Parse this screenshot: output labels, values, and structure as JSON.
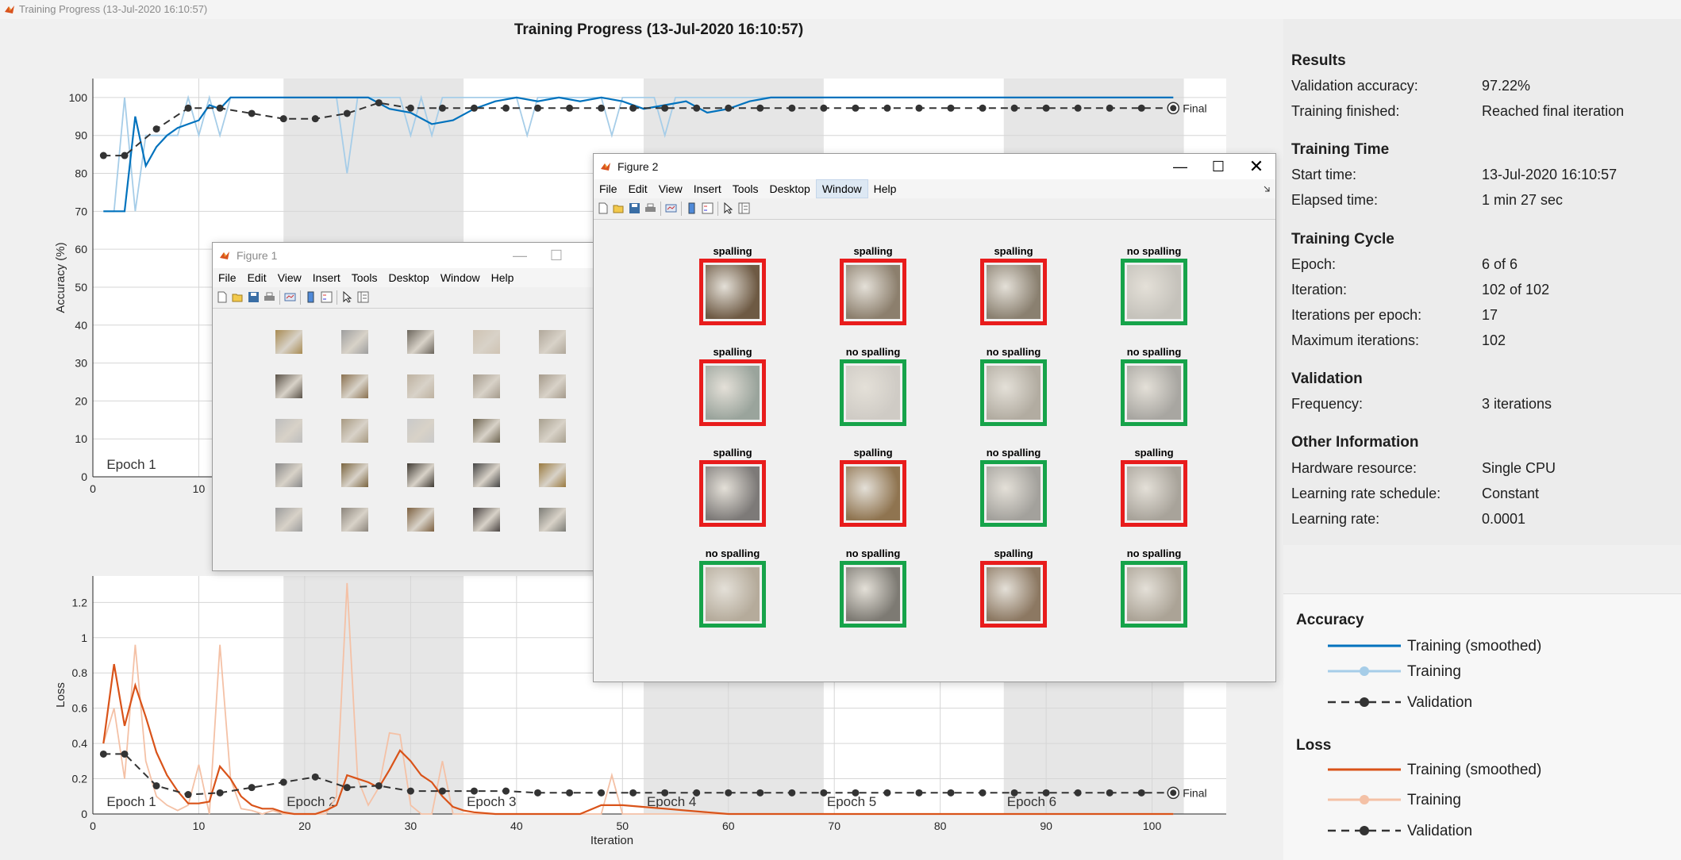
{
  "app_title": "Training Progress (13-Jul-2020 16:10:57)",
  "chart_title": "Training Progress (13-Jul-2020 16:10:57)",
  "colors": {
    "train_smooth_acc": "#0072BD",
    "train_acc": "#a6cde8",
    "train_smooth_loss": "#D95319",
    "train_loss": "#f4c1a6",
    "validation": "#333333",
    "epoch_shade": "#e6e6e6",
    "correct_border": "#16a34a",
    "wrong_border": "#e81c1c"
  },
  "chart_data": [
    {
      "type": "line",
      "ylabel": "Accuracy (%)",
      "xlim": [
        0,
        107
      ],
      "ylim": [
        0,
        105
      ],
      "yticks": [
        0,
        10,
        20,
        30,
        40,
        50,
        60,
        70,
        80,
        90,
        100
      ],
      "xticks": [
        0,
        10
      ],
      "epoch_labels": [
        "Epoch 1"
      ],
      "final_label": "Final",
      "series": [
        {
          "name": "Training (smoothed)",
          "x": [
            1,
            2,
            3,
            4,
            5,
            6,
            7,
            8,
            9,
            10,
            11,
            12,
            13,
            14,
            15,
            16,
            18,
            20,
            22,
            24,
            26,
            28,
            30,
            32,
            34,
            36,
            38,
            40,
            42,
            44,
            46,
            48,
            50,
            52,
            54,
            56,
            58,
            60,
            62,
            64,
            66,
            68,
            70,
            72,
            74,
            76,
            78,
            80,
            82,
            84,
            86,
            88,
            90,
            92,
            94,
            96,
            98,
            100,
            102
          ],
          "y": [
            70,
            70,
            70,
            95,
            82,
            87,
            90,
            92,
            93,
            94,
            98,
            97,
            100,
            100,
            100,
            100,
            100,
            100,
            100,
            100,
            100,
            97,
            96,
            93,
            94,
            97,
            99,
            100,
            99,
            100,
            99,
            100,
            99,
            97,
            98,
            99,
            96,
            97,
            99,
            100,
            100,
            100,
            100,
            100,
            100,
            100,
            100,
            100,
            100,
            100,
            100,
            100,
            100,
            100,
            100,
            100,
            100,
            100,
            100
          ]
        },
        {
          "name": "Training",
          "x": [
            1,
            2,
            3,
            4,
            5,
            6,
            7,
            8,
            9,
            10,
            11,
            12,
            13,
            14,
            15,
            16,
            18,
            20,
            22,
            23,
            24,
            25,
            26,
            27,
            28,
            29,
            30,
            31,
            32,
            33,
            34,
            35,
            36,
            38,
            40,
            41,
            42,
            43,
            44,
            45,
            46,
            47,
            48,
            49,
            50,
            51,
            52,
            53,
            54,
            55,
            56,
            58,
            60,
            62,
            64,
            66,
            68,
            70,
            72,
            74,
            76,
            78,
            80,
            82,
            84,
            86,
            88,
            90,
            92,
            94,
            96,
            98,
            100,
            102
          ],
          "y": [
            70,
            70,
            100,
            70,
            90,
            90,
            90,
            90,
            100,
            90,
            100,
            90,
            100,
            100,
            100,
            100,
            100,
            100,
            100,
            100,
            80,
            100,
            100,
            100,
            100,
            100,
            90,
            100,
            90,
            100,
            100,
            100,
            100,
            100,
            100,
            90,
            100,
            100,
            100,
            100,
            100,
            100,
            100,
            90,
            100,
            100,
            100,
            100,
            90,
            100,
            100,
            100,
            100,
            100,
            100,
            100,
            100,
            100,
            100,
            100,
            100,
            100,
            100,
            100,
            100,
            100,
            100,
            100,
            100,
            100,
            100,
            100,
            100,
            100
          ]
        },
        {
          "name": "Validation",
          "x": [
            1,
            3,
            6,
            9,
            12,
            15,
            18,
            21,
            24,
            27,
            30,
            33,
            36,
            39,
            42,
            45,
            48,
            51,
            54,
            57,
            60,
            63,
            66,
            69,
            72,
            75,
            78,
            81,
            84,
            87,
            90,
            93,
            96,
            99,
            102
          ],
          "y": [
            84.7,
            84.7,
            91.7,
            97.2,
            97.2,
            95.8,
            94.4,
            94.4,
            95.8,
            98.6,
            97.2,
            97.2,
            97.2,
            97.2,
            97.2,
            97.2,
            97.2,
            97.2,
            97.2,
            97.2,
            97.2,
            97.2,
            97.2,
            97.2,
            97.2,
            97.2,
            97.2,
            97.2,
            97.2,
            97.2,
            97.2,
            97.2,
            97.2,
            97.2,
            97.2
          ]
        }
      ]
    },
    {
      "type": "line",
      "ylabel": "Loss",
      "xlabel": "Iteration",
      "xlim": [
        0,
        107
      ],
      "ylim": [
        0,
        1.35
      ],
      "yticks": [
        0,
        0.2,
        0.4,
        0.6,
        0.8,
        1,
        1.2
      ],
      "ytick_labels": [
        "0",
        "0.2",
        "0.4",
        "0.6",
        "0.8",
        "1",
        "1.2"
      ],
      "xticks": [
        0,
        10,
        20,
        30,
        40,
        50,
        60,
        70,
        80,
        90,
        100
      ],
      "epoch_labels": [
        "Epoch 1",
        "Epoch 2",
        "Epoch 3",
        "Epoch 4",
        "Epoch 5",
        "Epoch 6"
      ],
      "final_label": "Final",
      "series": [
        {
          "name": "Training (smoothed)",
          "x": [
            1,
            2,
            3,
            4,
            5,
            6,
            7,
            8,
            9,
            10,
            11,
            12,
            13,
            14,
            15,
            16,
            17,
            18,
            19,
            20,
            21,
            22,
            23,
            24,
            25,
            26,
            27,
            28,
            29,
            30,
            31,
            32,
            33,
            34,
            35,
            36,
            38,
            40,
            42,
            44,
            46,
            48,
            50,
            52,
            54,
            56,
            58,
            60,
            62,
            64,
            66,
            68,
            70,
            72,
            74,
            76,
            78,
            80,
            82,
            84,
            86,
            88,
            90,
            92,
            94,
            96,
            98,
            100,
            102
          ],
          "y": [
            0.4,
            0.85,
            0.5,
            0.73,
            0.55,
            0.35,
            0.22,
            0.13,
            0.06,
            0.06,
            0.07,
            0.27,
            0.2,
            0.1,
            0.05,
            0.03,
            0.03,
            0.01,
            0.0,
            0.0,
            0.0,
            0.02,
            0.05,
            0.22,
            0.2,
            0.18,
            0.15,
            0.25,
            0.36,
            0.3,
            0.22,
            0.18,
            0.1,
            0.04,
            0.02,
            0.01,
            0.0,
            0.0,
            0.0,
            0.0,
            0.0,
            0.05,
            0.05,
            0.04,
            0.03,
            0.02,
            0.01,
            0.0,
            0.0,
            0.0,
            0.0,
            0.0,
            0.0,
            0.0,
            0.0,
            0.0,
            0.0,
            0.0,
            0.0,
            0.0,
            0.0,
            0.0,
            0.0,
            0.0,
            0.0,
            0.0,
            0.0,
            0.0,
            0.0
          ]
        },
        {
          "name": "Training",
          "x": [
            1,
            2,
            3,
            4,
            5,
            6,
            7,
            8,
            9,
            10,
            11,
            12,
            13,
            14,
            15,
            16,
            17,
            18,
            19,
            20,
            21,
            22,
            23,
            24,
            25,
            26,
            27,
            28,
            29,
            30,
            31,
            32,
            33,
            34,
            35,
            36,
            38,
            40,
            42,
            44,
            46,
            48,
            49,
            50,
            52,
            54,
            56,
            58,
            60,
            62,
            64,
            66,
            68,
            70,
            72,
            74,
            76,
            78,
            80,
            82,
            84,
            86,
            88,
            90,
            92,
            94,
            96,
            98,
            100,
            102
          ],
          "y": [
            0.4,
            0.6,
            0.2,
            0.96,
            0.3,
            0.1,
            0.05,
            0.02,
            0.05,
            0.28,
            0.0,
            0.96,
            0.2,
            0.03,
            0.02,
            0.0,
            0.02,
            0.0,
            0.0,
            0.0,
            0.0,
            0.0,
            0.1,
            1.31,
            0.2,
            0.05,
            0.15,
            0.46,
            0.45,
            0.05,
            0.0,
            0.0,
            0.3,
            0.0,
            0.0,
            0.0,
            0.0,
            0.0,
            0.0,
            0.0,
            0.0,
            0.0,
            0.22,
            0.0,
            0.0,
            0.0,
            0.0,
            0.0,
            0.0,
            0.0,
            0.0,
            0.0,
            0.0,
            0.0,
            0.0,
            0.0,
            0.0,
            0.0,
            0.0,
            0.0,
            0.0,
            0.0,
            0.0,
            0.0,
            0.0,
            0.0,
            0.0,
            0.0,
            0.0,
            0.0
          ]
        },
        {
          "name": "Validation",
          "x": [
            1,
            3,
            6,
            9,
            12,
            15,
            18,
            21,
            24,
            27,
            30,
            33,
            36,
            39,
            42,
            45,
            48,
            51,
            54,
            57,
            60,
            63,
            66,
            69,
            72,
            75,
            78,
            81,
            84,
            87,
            90,
            93,
            96,
            99,
            102
          ],
          "y": [
            0.34,
            0.34,
            0.16,
            0.11,
            0.12,
            0.15,
            0.18,
            0.21,
            0.15,
            0.16,
            0.13,
            0.13,
            0.13,
            0.13,
            0.12,
            0.12,
            0.12,
            0.12,
            0.12,
            0.12,
            0.12,
            0.12,
            0.12,
            0.12,
            0.12,
            0.12,
            0.12,
            0.12,
            0.12,
            0.12,
            0.12,
            0.12,
            0.12,
            0.12,
            0.12
          ]
        }
      ]
    }
  ],
  "results": {
    "title": "Results",
    "validation_accuracy_label": "Validation accuracy:",
    "validation_accuracy": "97.22%",
    "training_finished_label": "Training finished:",
    "training_finished": "Reached final iteration"
  },
  "training_time": {
    "title": "Training Time",
    "start_label": "Start time:",
    "start": "13-Jul-2020 16:10:57",
    "elapsed_label": "Elapsed time:",
    "elapsed": "1 min 27 sec"
  },
  "training_cycle": {
    "title": "Training Cycle",
    "epoch_label": "Epoch:",
    "epoch": "6 of 6",
    "iteration_label": "Iteration:",
    "iteration": "102 of 102",
    "ipe_label": "Iterations per epoch:",
    "ipe": "17",
    "max_label": "Maximum iterations:",
    "max": "102"
  },
  "validation": {
    "title": "Validation",
    "freq_label": "Frequency:",
    "freq": "3 iterations"
  },
  "other": {
    "title": "Other Information",
    "hw_label": "Hardware resource:",
    "hw": "Single CPU",
    "lrs_label": "Learning rate schedule:",
    "lrs": "Constant",
    "lr_label": "Learning rate:",
    "lr": "0.0001"
  },
  "legend": {
    "accuracy_title": "Accuracy",
    "loss_title": "Loss",
    "training_smoothed": "Training (smoothed)",
    "training": "Training",
    "validation": "Validation"
  },
  "figure1": {
    "title": "Figure 1",
    "menus": [
      "File",
      "Edit",
      "View",
      "Insert",
      "Tools",
      "Desktop",
      "Window",
      "Help"
    ],
    "image_tones": [
      "#a88b52",
      "#9e9e9e",
      "#6b655c",
      "#cfc3b3",
      "#b0a79a",
      "#5a5248",
      "#8a7150",
      "#bdb1a0",
      "#a49a8c",
      "#a59a8b",
      "#bdbdbd",
      "#a89a82",
      "#c9c9c9",
      "#6d6450",
      "#a8a08f",
      "#8a8a8a",
      "#7a6540",
      "#3f3a33",
      "#454545",
      "#9a7a40",
      "#9c9c9c",
      "#8c857c",
      "#7c6040",
      "#4a4442",
      "#7c7c76"
    ]
  },
  "figure2": {
    "title": "Figure 2",
    "menus": [
      "File",
      "Edit",
      "View",
      "Insert",
      "Tools",
      "Desktop",
      "Window",
      "Help"
    ],
    "selected_menu": "Window",
    "tiles": [
      {
        "label": "spalling",
        "correct": false,
        "tone": "#6e5a44"
      },
      {
        "label": "spalling",
        "correct": false,
        "tone": "#8c7f6d"
      },
      {
        "label": "spalling",
        "correct": false,
        "tone": "#8a8070"
      },
      {
        "label": "no spalling",
        "correct": true,
        "tone": "#c5c2bb"
      },
      {
        "label": "spalling",
        "correct": false,
        "tone": "#9aa49c"
      },
      {
        "label": "no spalling",
        "correct": true,
        "tone": "#cfcbc5"
      },
      {
        "label": "no spalling",
        "correct": true,
        "tone": "#b2aca1"
      },
      {
        "label": "no spalling",
        "correct": true,
        "tone": "#a8a6a1"
      },
      {
        "label": "spalling",
        "correct": false,
        "tone": "#7d7a78"
      },
      {
        "label": "spalling",
        "correct": false,
        "tone": "#8f7450"
      },
      {
        "label": "no spalling",
        "correct": true,
        "tone": "#a3a19c"
      },
      {
        "label": "spalling",
        "correct": false,
        "tone": "#a8a39a"
      },
      {
        "label": "no spalling",
        "correct": true,
        "tone": "#b5ab9b"
      },
      {
        "label": "no spalling",
        "correct": true,
        "tone": "#7d7a73"
      },
      {
        "label": "spalling",
        "correct": false,
        "tone": "#8c7862"
      },
      {
        "label": "no spalling",
        "correct": true,
        "tone": "#aba396"
      }
    ]
  }
}
